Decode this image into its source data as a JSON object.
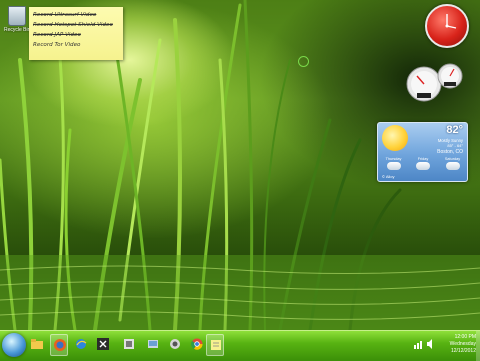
{
  "desktop": {
    "recycle_bin_label": "Recycle Bin"
  },
  "sticky_note": {
    "lines": [
      "Record Ultrasurf Video",
      "Record Hotspot Shield Video",
      "Record JAP Video",
      "Record Tor Video"
    ]
  },
  "weather": {
    "temperature": "82°",
    "condition": "Mostly Sunny",
    "range": "85° - 64°",
    "location": "Boston, CO",
    "forecast": [
      {
        "day": "Thursday"
      },
      {
        "day": "Friday"
      },
      {
        "day": "Saturday"
      }
    ],
    "source": "© Alloy"
  },
  "taskbar": {
    "icons": [
      "explorer-folder-icon",
      "firefox-icon",
      "internet-explorer-icon",
      "vs-icon",
      "ez-icon",
      "app-icon",
      "app-icon-2",
      "chrome-icon",
      "network-icon",
      "notes-icon"
    ]
  },
  "clock": {
    "time": "12:00 PM",
    "day": "Wednesday",
    "date": "12/12/2012"
  }
}
